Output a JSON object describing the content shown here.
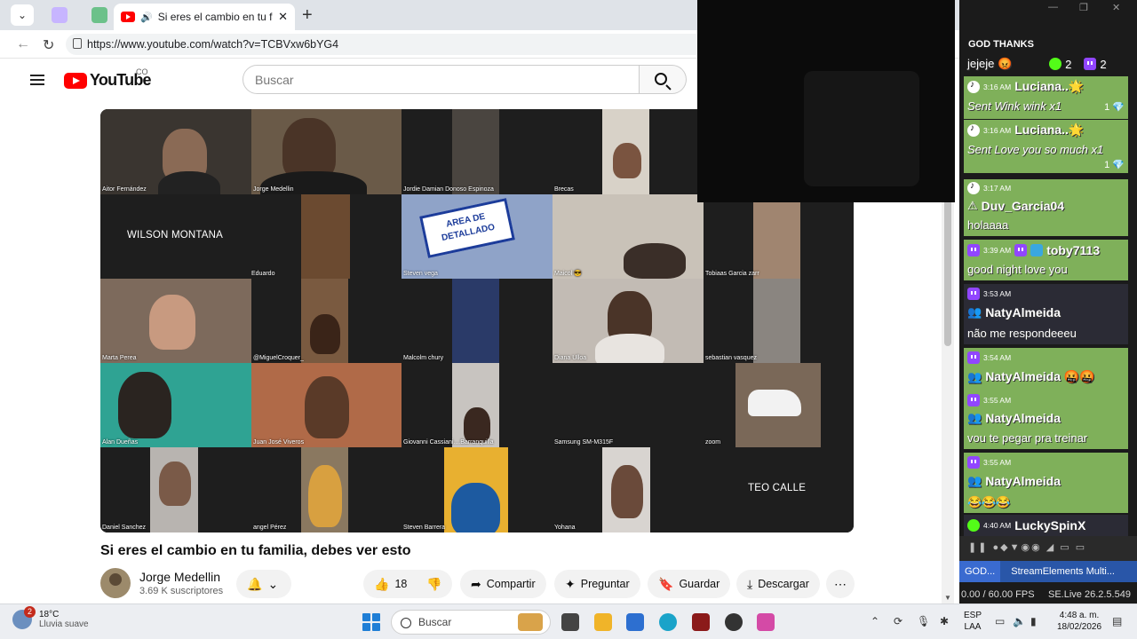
{
  "browser": {
    "tab_title": "Si eres el cambio en tu familia",
    "url": "https://www.youtube.com/watch?v=TCBVxw6bYG4"
  },
  "youtube": {
    "logo_text": "YouTube",
    "country": "CO",
    "search_placeholder": "Buscar"
  },
  "video": {
    "participants": {
      "aitor": "Aitor Fernández",
      "jorge": "Jorge Medellin",
      "jordie": "Jordie Damian Donoso Espinoza",
      "brecas": "Brecas",
      "wilson": "WILSON MONTANA",
      "eduardo": "Eduardo",
      "steven_vega": "Steven vega",
      "maicol": "Maicol 😎",
      "tobias": "Tobiaas Garcia zarr",
      "marta": "Marta Perea",
      "miguel": "@MiguelCroquer_",
      "malcolm": "Malcolm chury",
      "diana": "Diana Ulloa",
      "sebastian": "sebastian vasquez",
      "alan": "Alan Dueñas",
      "juan": "Juan José Viveros",
      "giovanni": "Giovanni Cassiani....Barranquilla",
      "samsung": "Samsung SM-M315F",
      "zoom": "zoom",
      "daniel": "Daniel Sanchez",
      "angel": "angel Pérez",
      "steven_barrera": "Steven Barrera",
      "yohana": "Yohana",
      "teo": "TEO CALLE"
    },
    "sign_text": "AREA DE DETALLADO",
    "title": "Si eres el cambio en tu familia, debes ver esto",
    "channel_name": "Jorge Medellin",
    "subscribers": "3.69 K suscriptores",
    "likes": "18",
    "actions": {
      "share": "Compartir",
      "ask": "Preguntar",
      "save": "Guardar",
      "download": "Descargar"
    }
  },
  "chat": {
    "header": "GOD THANKS",
    "first_text": "jejeje 😡",
    "kick_count": "2",
    "twitch_count": "2",
    "messages": [
      {
        "platform": "tiktok",
        "time": "3:16 AM",
        "user": "Luciana..🌟",
        "text": "Sent Wink wink x1",
        "gift": "1 💎"
      },
      {
        "platform": "tiktok",
        "time": "3:16 AM",
        "user": "Luciana..🌟",
        "text": "Sent Love you so much x1",
        "gift": "1 💎"
      },
      {
        "platform": "tiktok",
        "time": "3:17 AM",
        "user": "Duv_Garcia04",
        "text": "holaaaa"
      },
      {
        "platform": "twitch",
        "time": "3:39 AM",
        "user": "toby7113",
        "text": "good night love you"
      },
      {
        "platform": "twitch",
        "time": "3:53 AM",
        "user": "NatyAlmeida",
        "text": "não me respondeeeu"
      },
      {
        "platform": "twitch",
        "time": "3:54 AM",
        "user": "NatyAlmeida 🤬🤬",
        "text": ""
      },
      {
        "platform": "twitch",
        "time": "3:55 AM",
        "user": "NatyAlmeida",
        "text": "vou te pegar pra treinar"
      },
      {
        "platform": "twitch",
        "time": "3:55 AM",
        "user": "NatyAlmeida",
        "text": "😂😂😂"
      },
      {
        "platform": "kick",
        "time": "4:40 AM",
        "user": "LuckySpinX",
        "text": ""
      }
    ],
    "tabs": [
      "GOD...",
      "StreamElements Multi..."
    ],
    "fps": "0.00 / 60.00 FPS",
    "version": "SE.Live 26.2.5.549"
  },
  "taskbar": {
    "temp": "18°C",
    "weather": "Lluvia suave",
    "badge": "2",
    "search": "Buscar",
    "lang_top": "ESP",
    "lang_bottom": "LAA",
    "time": "4:48 a. m.",
    "date": "18/02/2026"
  },
  "colors": {
    "chat_green": "#7fb05a",
    "chat_dark": "#2b2b35",
    "youtube_red": "#ff0000",
    "twitch_purple": "#9146ff",
    "kick_green": "#53fc18"
  }
}
